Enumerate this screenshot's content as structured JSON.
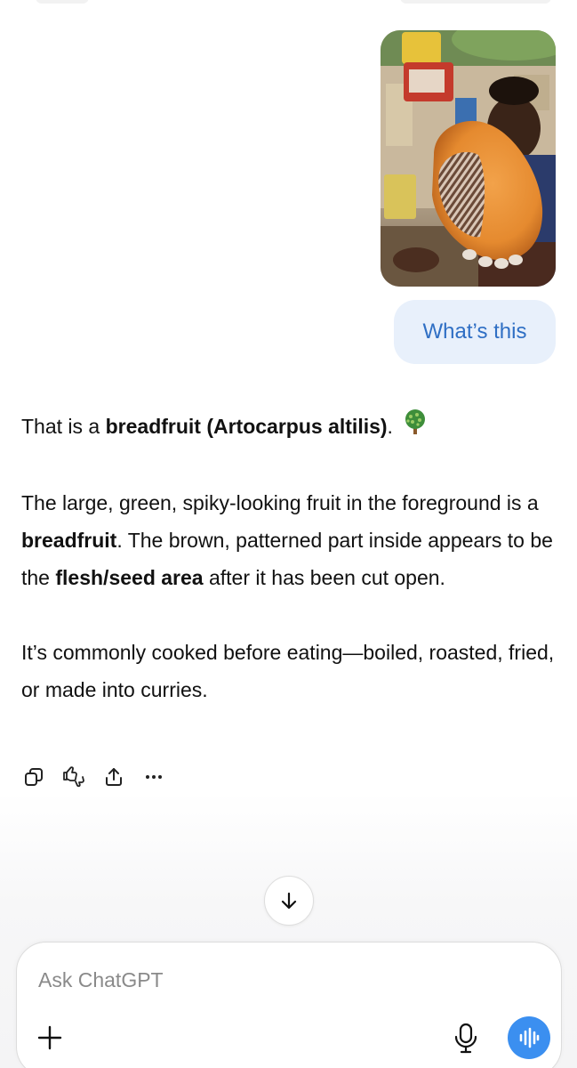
{
  "conversation": {
    "user_message": {
      "image_alt": "Man holding a cut-open orange fruit",
      "text": "What’s this"
    },
    "assistant_message": {
      "p1": {
        "t1": "That is a ",
        "b1": "breadfruit (Artocarpus altilis)",
        "t2": ".",
        "emoji_icon": "tree-emoji-icon"
      },
      "p2": {
        "t1": "The large, green, spiky-looking fruit in the foreground is a ",
        "b1": "breadfruit",
        "t2": ". The brown, patterned part inside appears to be the ",
        "b2": "flesh/seed area",
        "t3": " after it has been cut open."
      },
      "p3": {
        "t1": "It’s commonly cooked before eating—boiled, roasted, fried, or made into curries."
      }
    },
    "actions": [
      "copy-icon",
      "thumbs-up-down-icon",
      "share-icon",
      "more-icon"
    ]
  },
  "scroll_button": {
    "icon": "arrow-down-icon"
  },
  "composer": {
    "placeholder": "Ask ChatGPT",
    "value": "",
    "icons": [
      "plus-icon",
      "microphone-icon",
      "voice-mode-icon"
    ]
  },
  "colors": {
    "user_bubble_bg": "#e8f0fb",
    "user_bubble_text": "#2f6fc4",
    "voice_button": "#3b8ff0"
  }
}
